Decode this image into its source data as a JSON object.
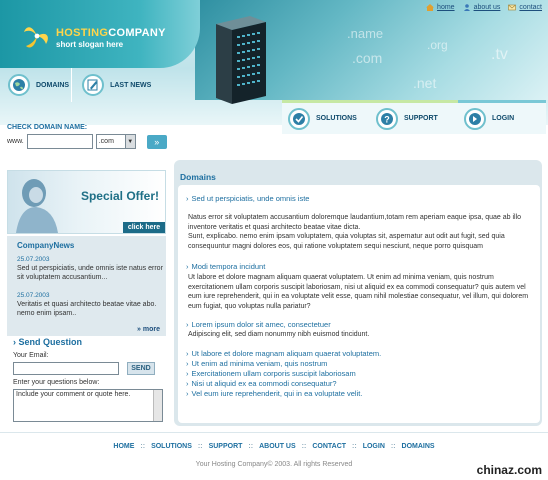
{
  "top_links": [
    {
      "label": "home",
      "icon": "home-icon"
    },
    {
      "label": "about us",
      "icon": "person-icon"
    },
    {
      "label": "contact",
      "icon": "envelope-icon"
    }
  ],
  "brand": {
    "name_part1": "HOSTING",
    "name_part2": "COMPANY",
    "slogan": "short slogan here"
  },
  "header_words": [
    ".name",
    ".org",
    ".com",
    ".tv",
    ".net"
  ],
  "nav_left": [
    {
      "label": "DOMAINS",
      "icon": "globe-icon"
    },
    {
      "label": "LAST NEWS",
      "icon": "pencil-icon"
    }
  ],
  "nav_right": [
    {
      "label": "SOLUTIONS",
      "icon": "check-icon"
    },
    {
      "label": "SUPPORT",
      "icon": "question-icon"
    },
    {
      "label": "LOGIN",
      "icon": "login-icon"
    }
  ],
  "check_domain": {
    "label": "CHECK DOMAIN NAME:",
    "prefix": "www.",
    "input_value": "",
    "tld_selected": ".com"
  },
  "offer": {
    "title": "Special Offer!",
    "link": "click here"
  },
  "news": {
    "heading": "CompanyNews",
    "items": [
      {
        "date": "25.07.2003",
        "text": "Sed ut perspiciatis, unde omnis iste natus error sit voluptatem accusantium..."
      },
      {
        "date": "25.07.2003",
        "text": "Veritatis et quasi architecto beatae vitae abo. nemo enim ipsam.."
      }
    ],
    "more": "more"
  },
  "send": {
    "title": "Send Question",
    "email_label": "Your Email:",
    "button": "SEND",
    "questions_label": "Enter your questions below:",
    "textarea_value": "Include your comment or quote here."
  },
  "main": {
    "title": "Domains",
    "bullet1": "Sed ut perspiciatis, unde omnis iste",
    "para1": "Natus error sit voluptatem accusantium doloremque laudantium,totam rem aperiam eaque ipsa, quae ab illo inventore veritatis et quasi architecto beatae vitae dicta.",
    "para2": "Sunt, explicabo. nemo enim ipsam voluptatem, quia voluptas sit, aspernatur aut odit aut fugit, sed quia consequuntur magni dolores eos, qui ratione voluptatem sequi nesciunt, neque porro quisquam",
    "bullet2": "Modi tempora incidunt",
    "para3": "Ut labore et dolore magnam aliquam quaerat voluptatem. Ut enim ad minima veniam, quis nostrum exercitationem ullam corporis suscipit laboriosam, nisi ut aliquid ex ea commodi consequatur? quis autem vel eum iure reprehenderit, qui in ea voluptate velit esse, quam nihil molestiae consequatur, vel illum, qui dolorem eum fugiat, quo voluptas nulla pariatur?",
    "bullet3": "Lorem ipsum dolor sit amec, consectetuer",
    "para4": "Adipiscing elit, sed diam nonummy nibh euismod tincidunt.",
    "list": [
      "Ut labore et dolore magnam aliquam quaerat voluptatem.",
      "Ut enim ad minima veniam, quis nostrum",
      "Exercitationem ullam corporis suscipit laboriosam",
      "Nisi ut aliquid ex ea commodi consequatur?",
      "Vel eum iure reprehenderit, qui in ea voluptate velit."
    ]
  },
  "footer": {
    "links": [
      "HOME",
      "SOLUTIONS",
      "SUPPORT",
      "ABOUT US",
      "CONTACT",
      "LOGIN",
      "DOMAINS"
    ],
    "copyright": "Your Hosting Company© 2003. All rights Reserved",
    "watermark": "chinaz.com"
  },
  "colors": {
    "accent_teal": "#1c97a5",
    "link_blue": "#1e6fa0",
    "panel_bg": "#dbe7ec"
  }
}
